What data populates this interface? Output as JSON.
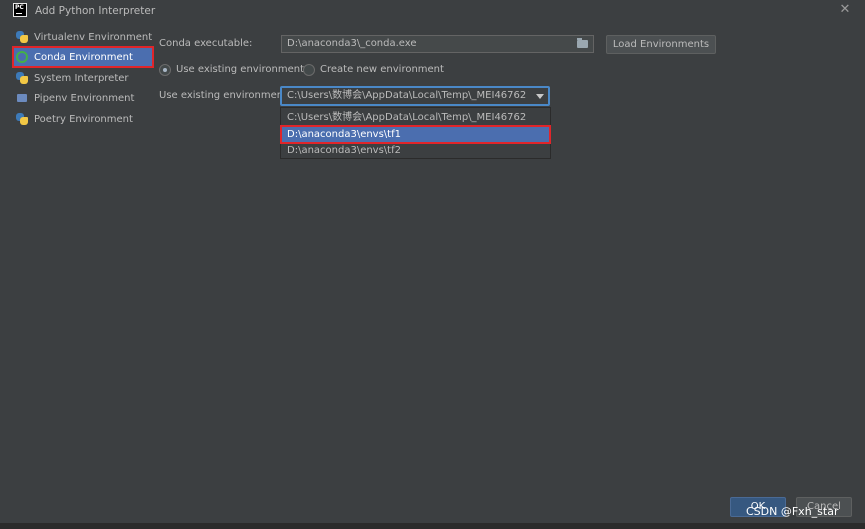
{
  "window": {
    "title": "Add Python Interpreter",
    "app_icon_text": "PC"
  },
  "sidebar": {
    "items": [
      {
        "label": "Virtualenv Environment",
        "icon": "python-icon"
      },
      {
        "label": "Conda Environment",
        "icon": "conda-icon",
        "selected": true
      },
      {
        "label": "System Interpreter",
        "icon": "python-icon"
      },
      {
        "label": "Pipenv Environment",
        "icon": "pipenv-icon"
      },
      {
        "label": "Poetry Environment",
        "icon": "python-icon"
      }
    ]
  },
  "form": {
    "conda_executable_label": "Conda executable:",
    "conda_executable_value": "D:\\anaconda3\\_conda.exe",
    "load_button": "Load Environments",
    "radio_existing": "Use existing environment",
    "radio_new": "Create new environment",
    "selected_radio": "existing",
    "existing_env_label": "Use existing environment:",
    "existing_env_value": "C:\\Users\\数博会\\AppData\\Local\\Temp\\_MEI46762",
    "dropdown_options": [
      "C:\\Users\\数博会\\AppData\\Local\\Temp\\_MEI46762",
      "D:\\anaconda3\\envs\\tf1",
      "D:\\anaconda3\\envs\\tf2"
    ],
    "highlighted_option_index": 1
  },
  "footer": {
    "ok": "OK",
    "cancel": "Cancel"
  },
  "watermark": "CSDN @Fxh_star",
  "colors": {
    "selection": "#4b6eaf",
    "annotation": "#e0252a",
    "background": "#3c3f41",
    "focus": "#4a88c7"
  }
}
